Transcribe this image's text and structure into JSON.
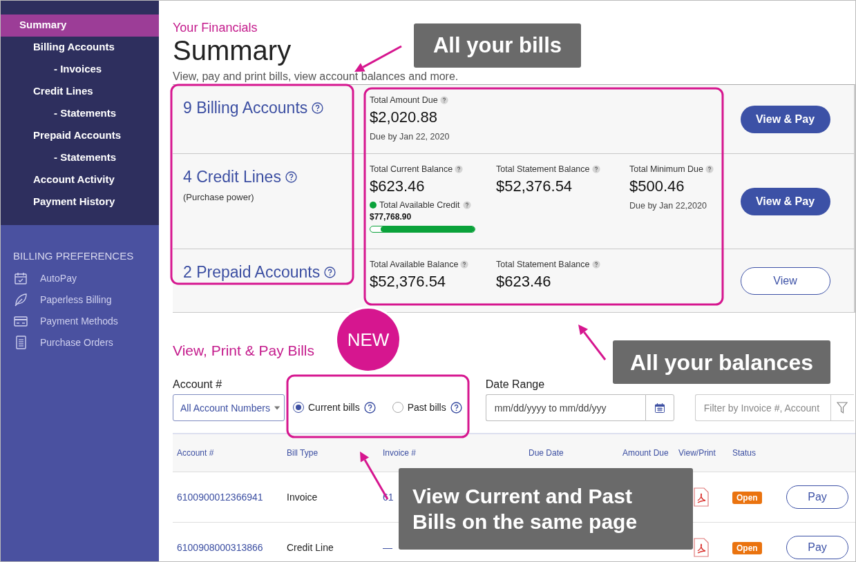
{
  "sidebar": {
    "nav": [
      {
        "label": "Summary",
        "selected": true,
        "children": [
          {
            "label": "Billing Accounts",
            "selected": false,
            "children": [
              {
                "label": "- Invoices",
                "selected": false
              }
            ]
          },
          {
            "label": "Credit Lines",
            "selected": false,
            "children": [
              {
                "label": "- Statements",
                "selected": false
              }
            ]
          },
          {
            "label": "Prepaid Accounts",
            "selected": false,
            "children": [
              {
                "label": "- Statements",
                "selected": false
              }
            ]
          },
          {
            "label": "Account Activity",
            "selected": false
          },
          {
            "label": "Payment History",
            "selected": false
          }
        ]
      }
    ],
    "preferences": {
      "heading": "BILLING PREFERENCES",
      "items": [
        {
          "label": "AutoPay"
        },
        {
          "label": "Paperless Billing"
        },
        {
          "label": "Payment Methods"
        },
        {
          "label": "Purchase Orders"
        }
      ]
    }
  },
  "header": {
    "eyebrow": "Your Financials",
    "title": "Summary",
    "subtitle": "View, pay and print bills, view account balances and more."
  },
  "summary": [
    {
      "kind": "billing",
      "title": "9 Billing Accounts",
      "metrics": [
        {
          "label": "Total Amount Due",
          "value": "$2,020.88",
          "sub": "Due by Jan 22, 2020"
        }
      ],
      "button": {
        "label": "View & Pay"
      }
    },
    {
      "kind": "credit",
      "title": "4 Credit Lines",
      "note": "(Purchase power)",
      "metrics": [
        {
          "label": "Total Current Balance",
          "value": "$623.46",
          "credit": {
            "label": "Total Available Credit",
            "value": "$77,768.90",
            "level": 0.9
          }
        },
        {
          "label": "Total Statement Balance",
          "value": "$52,376.54"
        },
        {
          "label": "Total Minimum Due",
          "value": "$500.46",
          "sub": "Due by Jan 22,2020"
        }
      ],
      "button": {
        "label": "View & Pay"
      }
    },
    {
      "kind": "prepaid",
      "title": "2 Prepaid Accounts",
      "metrics": [
        {
          "label": "Total Available Balance",
          "value": "$52,376.54"
        },
        {
          "label": "Total Statement Balance",
          "value": "$623.46"
        }
      ],
      "button": {
        "label": "View"
      }
    }
  ],
  "bills": {
    "title": "View, Print & Pay Bills",
    "account_label": "Account #",
    "account_value": "All Account Numbers",
    "radios": [
      {
        "label": "Current bills",
        "selected": true
      },
      {
        "label": "Past bills",
        "selected": false
      }
    ],
    "date_label": "Date Range",
    "date_placeholder": "mm/dd/yyyy to mm/dd/yyy",
    "filter_placeholder": "Filter by Invoice #, Account",
    "table": {
      "columns": [
        "Account #",
        "Bill Type",
        "Invoice #",
        "Due Date",
        "Amount Due",
        "View/Print",
        "Status"
      ],
      "rows": [
        {
          "account": "6100900012366941",
          "bill_type": "Invoice",
          "invoice": "61",
          "status": "Open",
          "action": "Pay"
        },
        {
          "account": "6100908000313866",
          "bill_type": "Credit Line",
          "invoice": "—",
          "status": "Open",
          "action": "Pay"
        }
      ]
    }
  },
  "annotations": [
    {
      "kind": "label",
      "text": "All your bills"
    },
    {
      "kind": "badge",
      "text": "NEW"
    },
    {
      "kind": "label",
      "text": "All your balances"
    },
    {
      "kind": "label",
      "text": "View Current and Past Bills on the same page"
    }
  ]
}
